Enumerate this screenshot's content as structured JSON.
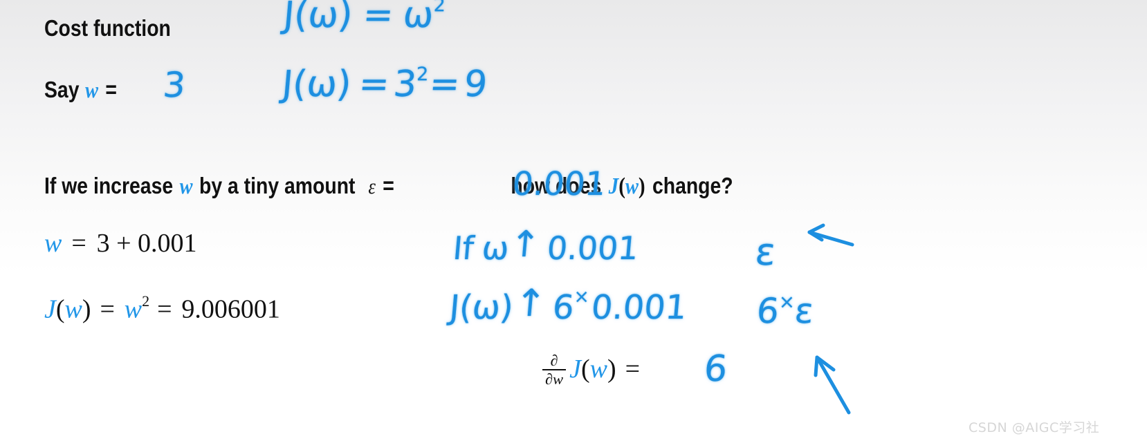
{
  "slide": {
    "background_top": "#e9e9ea",
    "background_bottom": "#ffffff",
    "ink_color": "#1d8fe0",
    "text_color": "#111111"
  },
  "printed": {
    "cost_function_label": "Cost function",
    "say_prefix": "Say",
    "say_var": "w",
    "say_equals": "=",
    "increase_part1": "If we increase",
    "increase_var": "w",
    "increase_part2": "by a tiny amount",
    "epsilon_symbol": "ε",
    "epsilon_equals": "=",
    "increase_part3": "how does",
    "increase_J": "J",
    "increase_open": "(",
    "increase_w2": "w",
    "increase_close": ")",
    "increase_part4": "change?"
  },
  "equations": {
    "w_line": {
      "var": "w",
      "equals": "=",
      "value": "3 + 0.001"
    },
    "J_line": {
      "J": "J",
      "open": "(",
      "w": "w",
      "close": ")",
      "equals1": "=",
      "w2": "w",
      "exponent": "2",
      "equals2": "=",
      "value": "9.006001"
    },
    "derivative_line": {
      "frac_num": "∂",
      "frac_den": "∂w",
      "J": "J",
      "open": "(",
      "w": "w",
      "close": ")",
      "equals": "=",
      "answer": "6"
    }
  },
  "handwriting": {
    "top_formula": {
      "J": "J(ω)",
      "equals": "=",
      "w": "ω",
      "exponent": "2"
    },
    "second_formula": {
      "J": "J(ω)",
      "equals1": "=",
      "base": "3",
      "exponent": "2",
      "equals2": "=",
      "result": "9"
    },
    "say_value": "3",
    "epsilon_value": "0.001",
    "note_line1": {
      "text_if": "If",
      "variable": "ω",
      "arrow": "↑",
      "amount": "0.001"
    },
    "note_line2": {
      "function": "J(ω)",
      "arrow": "↑",
      "coefficient": "6",
      "times": "×",
      "amount": "0.001"
    },
    "epsilon_label": "ε",
    "six_eps": {
      "coefficient": "6",
      "times": "×",
      "epsilon": "ε"
    },
    "derivative_answer": "6",
    "arrow_to_epsilon": "left-arrow",
    "arrow_to_six_eps": "up-left-arrow"
  },
  "watermark": {
    "text": "CSDN @AIGC学习社"
  }
}
